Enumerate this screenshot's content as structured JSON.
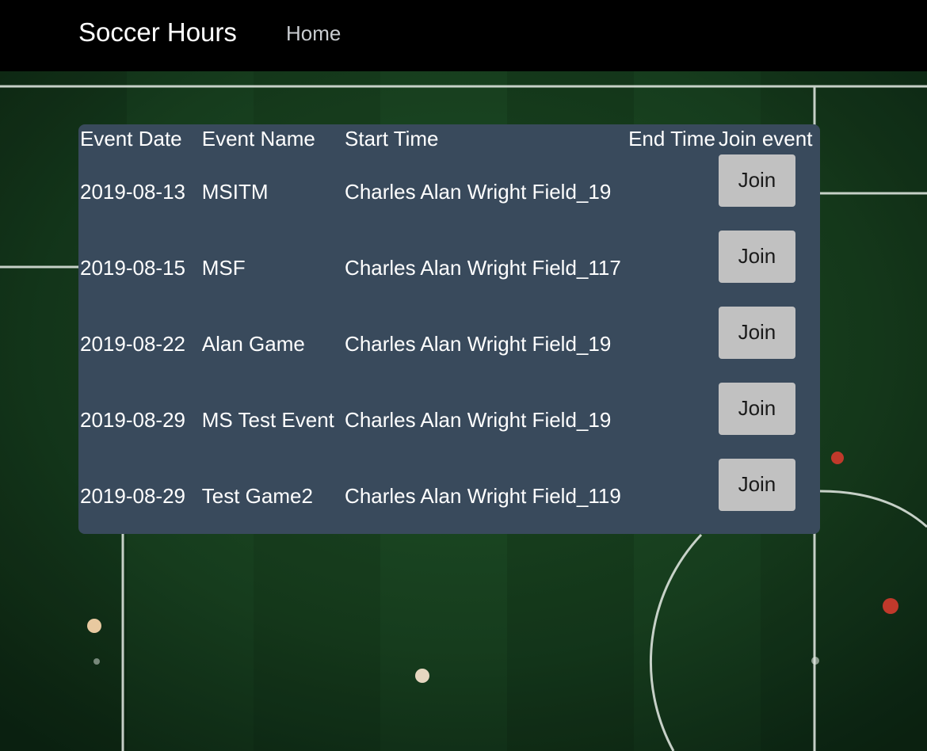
{
  "navbar": {
    "brand": "Soccer Hours",
    "home_link": "Home"
  },
  "events_table": {
    "headers": {
      "event_date": "Event Date",
      "event_name": "Event Name",
      "start_time": "Start Time",
      "end_time": "End Time",
      "join_event": "Join event"
    },
    "rows": [
      {
        "date": "2019-08-13",
        "name": "MSITM",
        "start": "Charles Alan Wright Field_19",
        "end": "",
        "join_label": "Join"
      },
      {
        "date": "2019-08-15",
        "name": "MSF",
        "start": "Charles Alan Wright Field_117",
        "end": "",
        "join_label": "Join"
      },
      {
        "date": "2019-08-22",
        "name": "Alan Game",
        "start": "Charles Alan Wright Field_19",
        "end": "",
        "join_label": "Join"
      },
      {
        "date": "2019-08-29",
        "name": "MS Test Event",
        "start": "Charles Alan Wright Field_19",
        "end": "",
        "join_label": "Join"
      },
      {
        "date": "2019-08-29",
        "name": "Test Game2",
        "start": "Charles Alan Wright Field_119",
        "end": "",
        "join_label": "Join"
      }
    ]
  },
  "colors": {
    "navbar_bg": "#000000",
    "panel_bg": "#394a5c",
    "button_bg": "#c1c1c1",
    "field_green": "#1d4a24"
  }
}
